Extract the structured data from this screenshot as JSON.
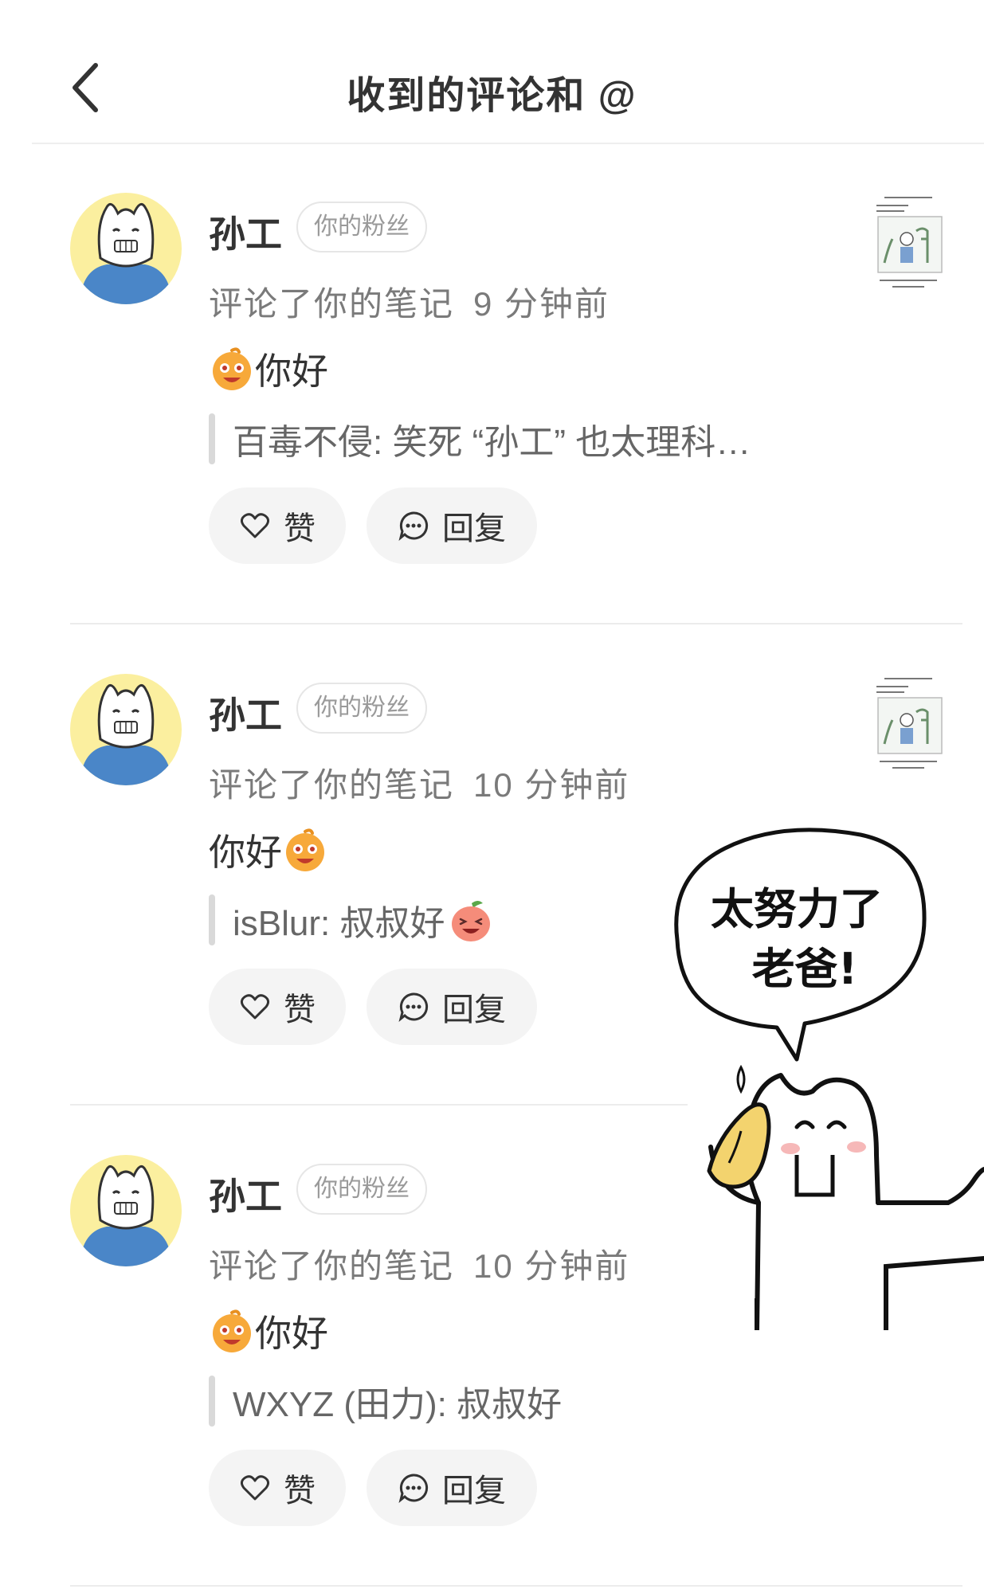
{
  "header": {
    "title": "收到的评论和 @",
    "back_icon": "chevron-left-icon"
  },
  "items": [
    {
      "name": "孙工",
      "badge": "你的粉丝",
      "action": "评论了你的笔记",
      "time": "9 分钟前",
      "comment_text": "你好",
      "comment_emoji_position": "before",
      "quote_text": "百毒不侵: 笑死 “孙工” 也太理科…",
      "quote_emoji": false,
      "like_label": "赞",
      "reply_label": "回复"
    },
    {
      "name": "孙工",
      "badge": "你的粉丝",
      "action": "评论了你的笔记",
      "time": "10 分钟前",
      "comment_text": "你好",
      "comment_emoji_position": "after",
      "quote_text": "isBlur: 叔叔好",
      "quote_emoji": true,
      "like_label": "赞",
      "reply_label": "回复"
    },
    {
      "name": "孙工",
      "badge": "你的粉丝",
      "action": "评论了你的笔记",
      "time": "10 分钟前",
      "comment_text": "你好",
      "comment_emoji_position": "before",
      "quote_text": "WXYZ (田力): 叔叔好",
      "quote_emoji": false,
      "like_label": "赞",
      "reply_label": "回复"
    }
  ],
  "doodle": {
    "speech_line1": "太努力了",
    "speech_line2": "老爸!"
  },
  "colors": {
    "avatar_bg": "#fbef9f",
    "avatar_shirt": "#4a86c8",
    "button_bg": "#f4f4f4",
    "divider": "#ececec"
  }
}
